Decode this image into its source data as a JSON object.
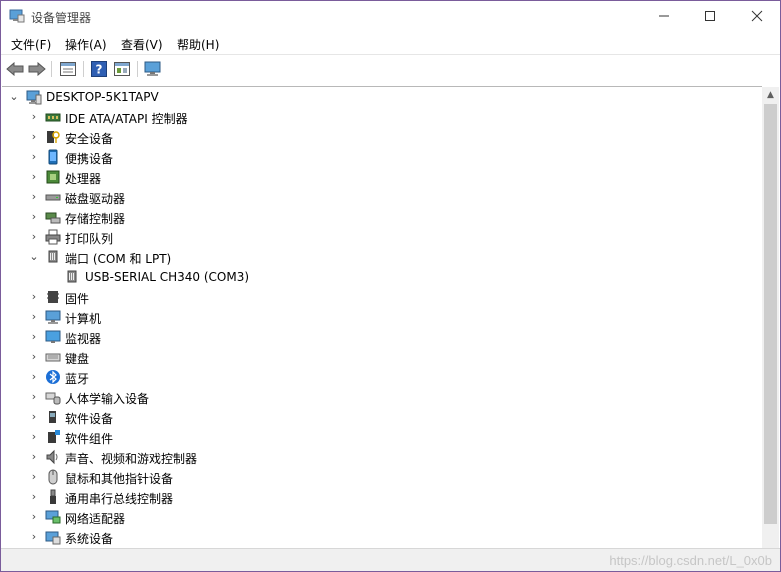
{
  "window": {
    "title": "设备管理器"
  },
  "menu": [
    "文件(F)",
    "操作(A)",
    "查看(V)",
    "帮助(H)"
  ],
  "toolbar": {
    "back": "back-arrow-icon",
    "forward": "forward-arrow-icon",
    "properties": "properties-icon",
    "help": "help-icon",
    "update": "update-driver-icon",
    "scan": "scan-hardware-icon"
  },
  "tree": {
    "root": "DESKTOP-5K1TAPV",
    "items": [
      {
        "label": "IDE ATA/ATAPI 控制器",
        "icon": "ide-controller"
      },
      {
        "label": "安全设备",
        "icon": "security"
      },
      {
        "label": "便携设备",
        "icon": "portable"
      },
      {
        "label": "处理器",
        "icon": "cpu"
      },
      {
        "label": "磁盘驱动器",
        "icon": "disk"
      },
      {
        "label": "存储控制器",
        "icon": "storage"
      },
      {
        "label": "打印队列",
        "icon": "printer"
      },
      {
        "label": "端口 (COM 和 LPT)",
        "icon": "port",
        "expanded": true,
        "children": [
          {
            "label": "USB-SERIAL CH340 (COM3)",
            "icon": "port"
          }
        ]
      },
      {
        "label": "固件",
        "icon": "firmware"
      },
      {
        "label": "计算机",
        "icon": "computer"
      },
      {
        "label": "监视器",
        "icon": "monitor"
      },
      {
        "label": "键盘",
        "icon": "keyboard"
      },
      {
        "label": "蓝牙",
        "icon": "bluetooth"
      },
      {
        "label": "人体学输入设备",
        "icon": "hid"
      },
      {
        "label": "软件设备",
        "icon": "software-device"
      },
      {
        "label": "软件组件",
        "icon": "software-component"
      },
      {
        "label": "声音、视频和游戏控制器",
        "icon": "sound"
      },
      {
        "label": "鼠标和其他指针设备",
        "icon": "mouse"
      },
      {
        "label": "通用串行总线控制器",
        "icon": "usb"
      },
      {
        "label": "网络适配器",
        "icon": "network"
      },
      {
        "label": "系统设备",
        "icon": "system"
      }
    ]
  },
  "status": {
    "watermark": "https://blog.csdn.net/L_0x0b"
  }
}
